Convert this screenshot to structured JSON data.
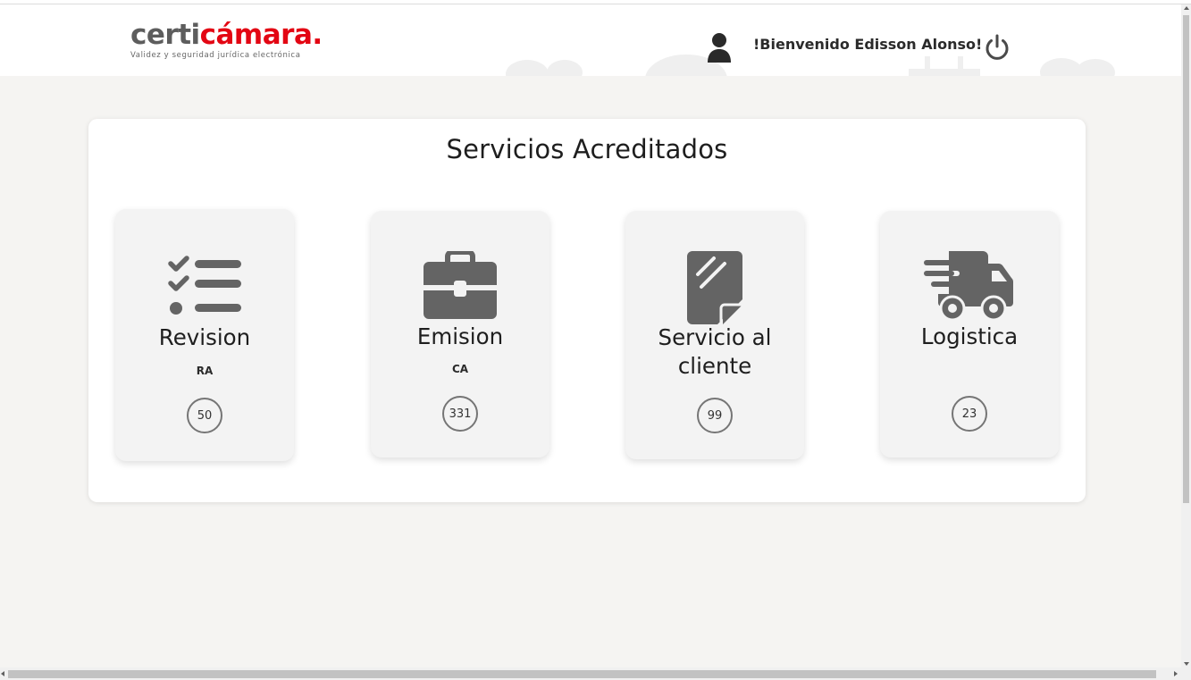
{
  "header": {
    "logo": {
      "part1": "certi",
      "part2": "cámara.",
      "tagline": "Validez y seguridad jurídica electrónica"
    },
    "welcome_text": "!Bienvenido Edisson Alonso!",
    "user_icon": "user-icon",
    "power_icon": "power-icon"
  },
  "panel": {
    "title": "Servicios Acreditados",
    "services": [
      {
        "name": "Revision",
        "code": "RA",
        "count": "50",
        "icon": "checklist-icon"
      },
      {
        "name": "Emision",
        "code": "CA",
        "count": "331",
        "icon": "briefcase-icon"
      },
      {
        "name": "Servicio al cliente",
        "code": "",
        "count": "99",
        "icon": "document-icon"
      },
      {
        "name": "Logistica",
        "code": "",
        "count": "23",
        "icon": "truck-icon"
      }
    ]
  },
  "colors": {
    "brand_red": "#e30613",
    "brand_gray": "#5d5d5d",
    "icon_gray": "#646464",
    "background": "#f5f4f2"
  }
}
